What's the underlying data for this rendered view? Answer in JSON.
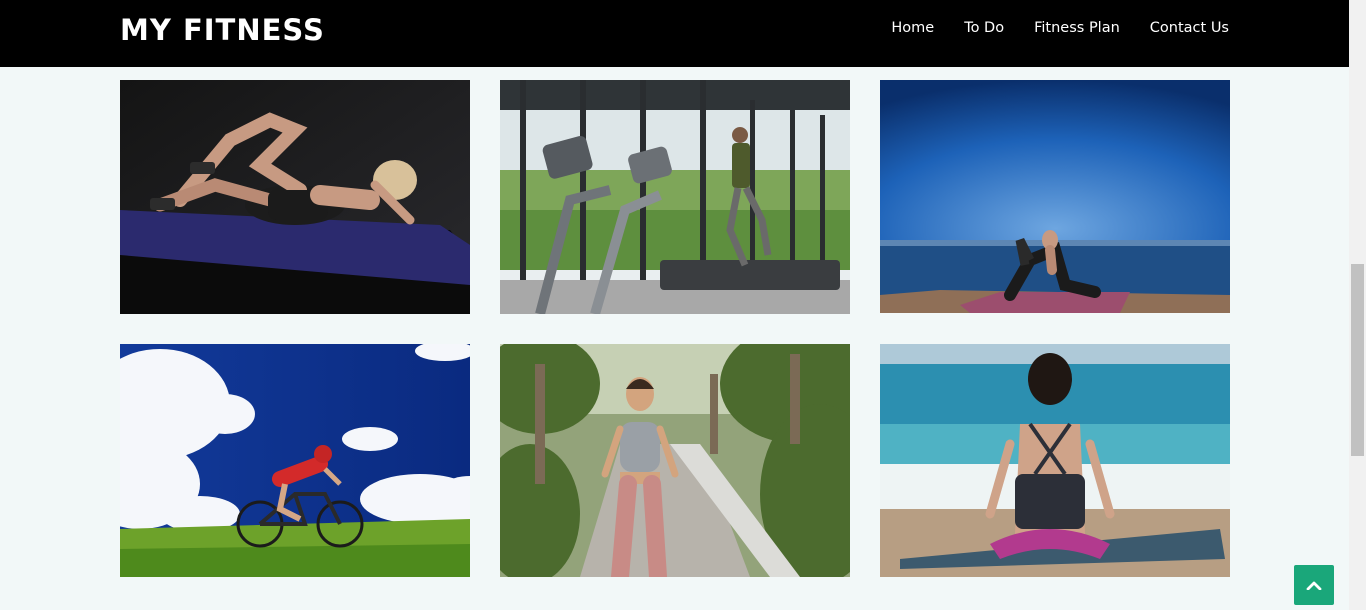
{
  "brand": {
    "title": "MY FITNESS"
  },
  "nav": {
    "items": [
      {
        "label": "Home"
      },
      {
        "label": "To Do"
      },
      {
        "label": "Fitness Plan"
      },
      {
        "label": "Contact Us"
      }
    ]
  },
  "gallery": {
    "images": [
      {
        "subject": "woman doing crunches on purple mat"
      },
      {
        "subject": "man running on treadmill in gym"
      },
      {
        "subject": "woman doing yoga pose by the sea"
      },
      {
        "subject": "cyclist riding road bike under blue sky"
      },
      {
        "subject": "woman jogging on park path"
      },
      {
        "subject": "woman meditating on beach"
      }
    ]
  },
  "back_to_top": {
    "icon": "chevron-up-icon"
  },
  "colors": {
    "navbar": "#000000",
    "page_background": "#f2f8f8",
    "accent": "#1aa77a"
  }
}
